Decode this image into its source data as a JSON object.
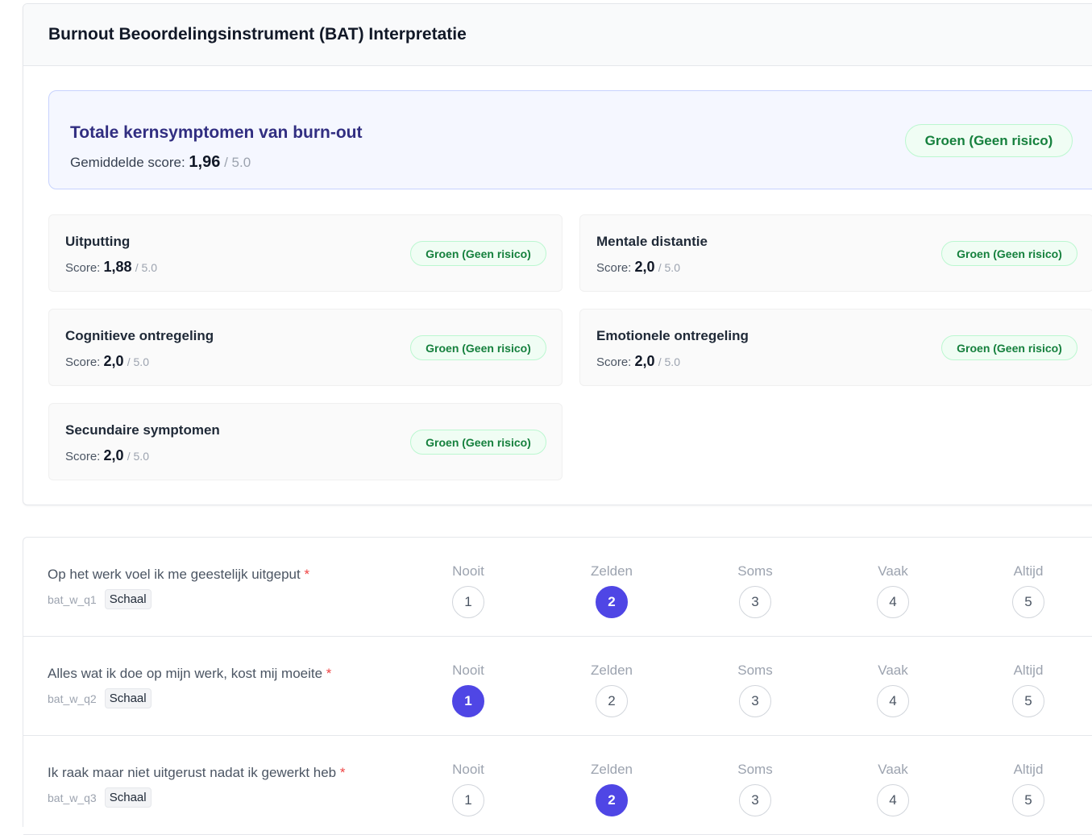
{
  "interpretation": {
    "title": "Burnout Beoordelingsinstrument (BAT) Interpretatie",
    "total": {
      "title": "Totale kernsymptomen van burn-out",
      "score_label": "Gemiddelde score:",
      "score": "1,96",
      "max": "/ 5.0",
      "badge": "Groen (Geen risico)",
      "badge_color": "#15803d"
    },
    "score_label": "Score:",
    "max": "/ 5.0",
    "subscales": [
      {
        "title": "Uitputting",
        "score": "1,88",
        "badge": "Groen (Geen risico)"
      },
      {
        "title": "Mentale distantie",
        "score": "2,0",
        "badge": "Groen (Geen risico)"
      },
      {
        "title": "Cognitieve ontregeling",
        "score": "2,0",
        "badge": "Groen (Geen risico)"
      },
      {
        "title": "Emotionele ontregeling",
        "score": "2,0",
        "badge": "Groen (Geen risico)"
      },
      {
        "title": "Secundaire symptomen",
        "score": "2,0",
        "badge": "Groen (Geen risico)"
      }
    ]
  },
  "questions": {
    "required_mark": "*",
    "tag": "Schaal",
    "options": [
      {
        "label": "Nooit",
        "value": "1"
      },
      {
        "label": "Zelden",
        "value": "2"
      },
      {
        "label": "Soms",
        "value": "3"
      },
      {
        "label": "Vaak",
        "value": "4"
      },
      {
        "label": "Altijd",
        "value": "5"
      }
    ],
    "items": [
      {
        "text": "Op het werk voel ik me geestelijk uitgeput",
        "id": "bat_w_q1",
        "selected": "2"
      },
      {
        "text": "Alles wat ik doe op mijn werk, kost mij moeite",
        "id": "bat_w_q2",
        "selected": "1"
      },
      {
        "text": "Ik raak maar niet uitgerust nadat ik gewerkt heb",
        "id": "bat_w_q3",
        "selected": "2"
      }
    ],
    "selected_color": "#4f46e5"
  }
}
